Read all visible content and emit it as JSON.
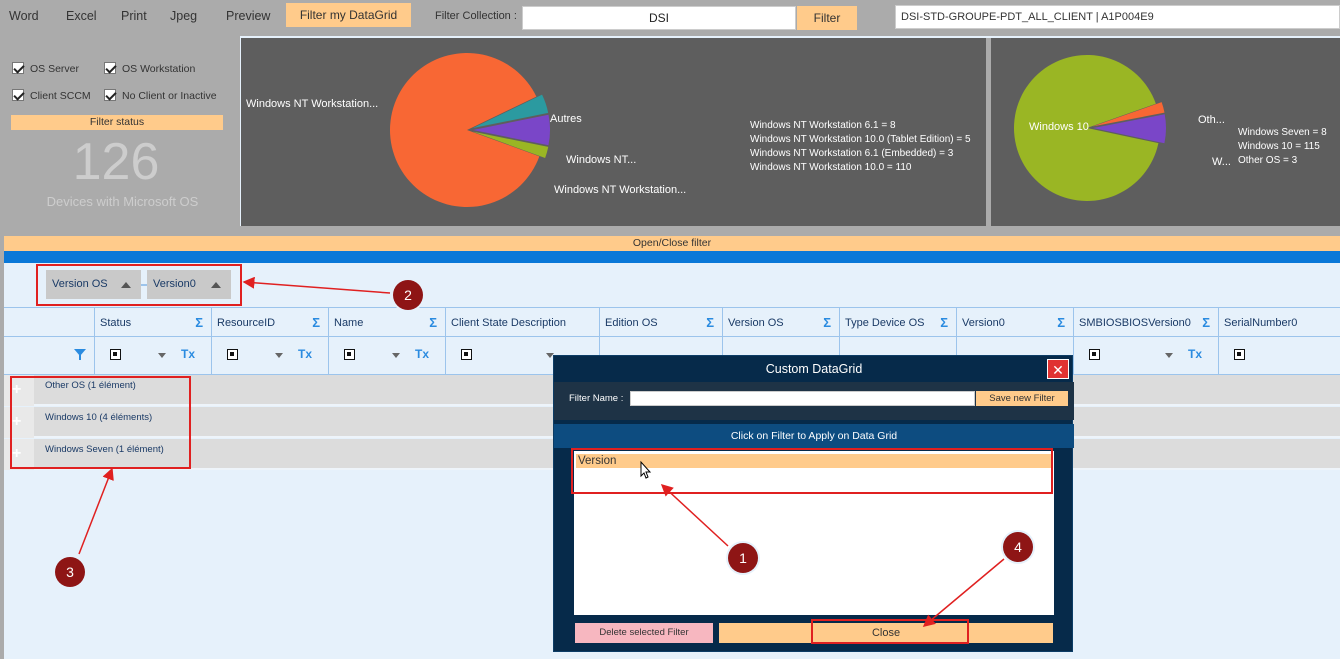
{
  "toolbar": {
    "word": "Word",
    "excel": "Excel",
    "print": "Print",
    "jpeg": "Jpeg",
    "preview": "Preview",
    "filter_my_datagrid": "Filter my DataGrid",
    "filter_collection_label": "Filter Collection :",
    "filter_collection_value": "DSI",
    "filter_button": "Filter",
    "collection_name": "DSI-STD-GROUPE-PDT_ALL_CLIENT  |  A1P004E9"
  },
  "stats": {
    "checkboxes": [
      "OS Server",
      "OS Workstation",
      "Client SCCM",
      "No Client or Inactive"
    ],
    "filter_status": "Filter status",
    "count": "126",
    "count_label": "Devices with Microsoft OS"
  },
  "chart_data": [
    {
      "type": "pie",
      "labels": [
        "Windows NT Workstation...",
        "Autres",
        "Windows NT...",
        "Windows NT Workstation..."
      ],
      "legend_lines": [
        "Windows NT Workstation 6.1 = 8",
        "Windows NT Workstation 10.0 (Tablet Edition) = 5",
        "Windows NT Workstation 6.1 (Embedded) = 3",
        "Windows NT Workstation 10.0 = 110"
      ],
      "slices": [
        {
          "name": "Windows NT Workstation 10.0",
          "value": 110,
          "color": "#f86734"
        },
        {
          "name": "Windows NT Workstation 6.1",
          "value": 8,
          "color": "#7a46c8"
        },
        {
          "name": "Windows NT Workstation 10.0 (Tablet Edition)",
          "value": 5,
          "color": "#2b9aa0"
        },
        {
          "name": "Windows NT Workstation 6.1 (Embedded)",
          "value": 3,
          "color": "#9ab624"
        }
      ]
    },
    {
      "type": "pie",
      "labels": [
        "Windows 10",
        "Oth...",
        "W..."
      ],
      "legend_lines": [
        "Windows Seven = 8",
        "Windows 10 = 115",
        "Other OS = 3"
      ],
      "slices": [
        {
          "name": "Windows 10",
          "value": 115,
          "color": "#9ab624"
        },
        {
          "name": "Other OS",
          "value": 3,
          "color": "#f86734"
        },
        {
          "name": "Windows Seven",
          "value": 8,
          "color": "#7a46c8"
        }
      ]
    }
  ],
  "open_close_filter": "Open/Close filter",
  "group_chips": [
    "Version OS",
    "Version0"
  ],
  "columns": [
    "Status",
    "ResourceID",
    "Name",
    "Client State Description",
    "Edition OS",
    "Version OS",
    "Type Device OS",
    "Version0",
    "SMBIOSBIOSVersion0",
    "SerialNumber0"
  ],
  "sigma": "Σ",
  "groups": [
    "Other OS (1 élément)",
    "Windows 10 (4 éléments)",
    "Windows Seven (1 élément)"
  ],
  "modal": {
    "title": "Custom DataGrid",
    "close_x": "✕",
    "filter_name_label": "Filter Name :",
    "save_button": "Save new Filter",
    "apply_text": "Click on Filter to Apply on Data Grid",
    "filters": [
      "Version"
    ],
    "delete_button": "Delete selected Filter",
    "close_button": "Close"
  },
  "annotations": [
    "1",
    "2",
    "3",
    "4"
  ]
}
